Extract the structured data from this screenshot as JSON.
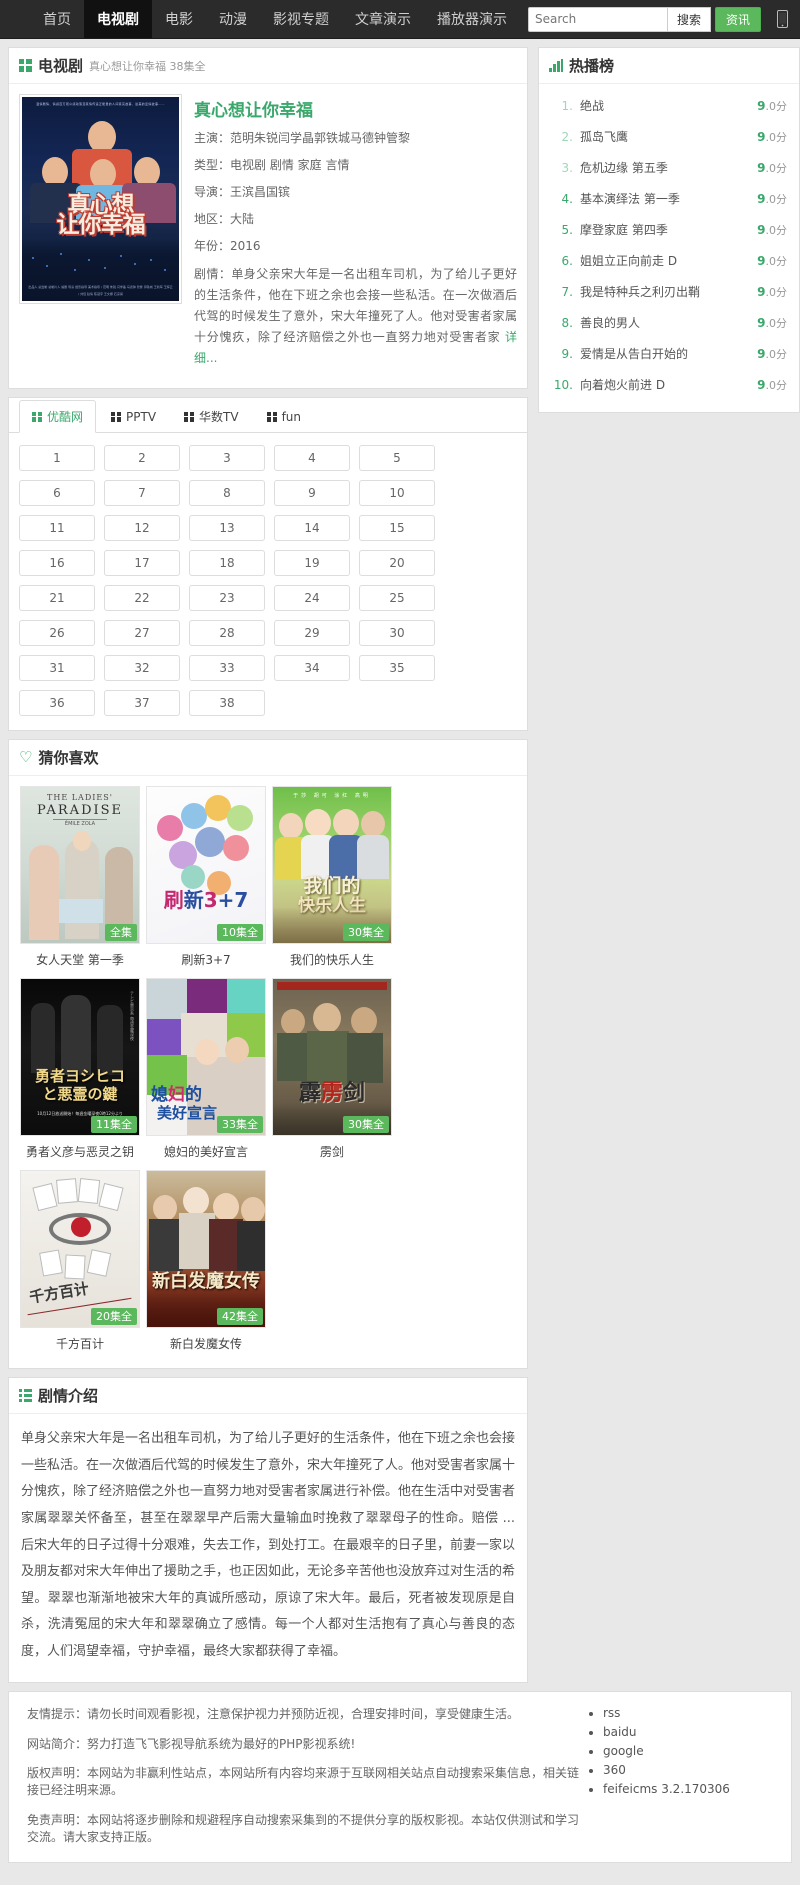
{
  "nav": {
    "items": [
      {
        "label": "首页",
        "active": false
      },
      {
        "label": "电视剧",
        "active": true
      },
      {
        "label": "电影",
        "active": false
      },
      {
        "label": "动漫",
        "active": false
      },
      {
        "label": "影视专题",
        "active": false
      },
      {
        "label": "文章演示",
        "active": false
      },
      {
        "label": "播放器演示",
        "active": false
      }
    ],
    "search_placeholder": "Search",
    "search_value": "",
    "search_button": "搜索",
    "news_button": "资讯",
    "mobile_icon": "mobile-phone-icon"
  },
  "detail": {
    "header_title": "电视剧",
    "header_sub": "真心想让你幸福 38集全",
    "header_icon": "tv-grid-icon",
    "poster_title_line1": "真心想",
    "poster_title_line2": "让你幸福",
    "poster_top_text": "温情剧情、情感百万观众感动落泪真情传递正能量的人间真实故事、最美的爱情故事……",
    "poster_credits": "出品人 总监制 总制片人 编剧 导演 摄影指导 美术指导 / 范明 朱锐 闫学晶 马德钟 管黎 郭铁城 王新军 王辉云 / 刘佳 赵倩 陈冠宇 王文娜 石凉澜",
    "title": "真心想让你幸福",
    "fields": [
      {
        "label": "主演",
        "value": "范明朱锐闫学晶郭铁城马德钟管黎"
      },
      {
        "label": "类型",
        "value": "电视剧 剧情 家庭 言情"
      },
      {
        "label": "导演",
        "value": "王滨昌国镔"
      },
      {
        "label": "地区",
        "value": "大陆"
      },
      {
        "label": "年份",
        "value": "2016"
      }
    ],
    "plot_label": "剧情",
    "plot_excerpt": "单身父亲宋大年是一名出租车司机，为了给儿子更好的生活条件，他在下班之余也会接一些私活。在一次做酒后代驾的时候发生了意外，宋大年撞死了人。他对受害者家属十分愧疚，除了经济赔偿之外也一直努力地对受害者家",
    "more_label": "详细..."
  },
  "sources": {
    "tabs": [
      {
        "label": "优酷网",
        "active": true
      },
      {
        "label": "PPTV",
        "active": false
      },
      {
        "label": "华数TV",
        "active": false
      },
      {
        "label": "fun",
        "active": false
      }
    ],
    "episodes": [
      "1",
      "2",
      "3",
      "4",
      "5",
      "6",
      "7",
      "8",
      "9",
      "10",
      "11",
      "12",
      "13",
      "14",
      "15",
      "16",
      "17",
      "18",
      "19",
      "20",
      "21",
      "22",
      "23",
      "24",
      "25",
      "26",
      "27",
      "28",
      "29",
      "30",
      "31",
      "32",
      "33",
      "34",
      "35",
      "36",
      "37",
      "38"
    ]
  },
  "recommend": {
    "header_title": "猜你喜欢",
    "header_icon": "heart-icon",
    "items": [
      {
        "name": "女人天堂 第一季",
        "badge": "全集",
        "poster_style": "ladies"
      },
      {
        "name": "刷新3+7",
        "badge": "10集全",
        "poster_style": "refresh"
      },
      {
        "name": "我们的快乐人生",
        "badge": "30集全",
        "poster_style": "happylife"
      },
      {
        "name": "勇者义彦与恶灵之钥",
        "badge": "11集全",
        "poster_style": "yoshihiko"
      },
      {
        "name": "媳妇的美好宣言",
        "badge": "33集全",
        "poster_style": "xifu"
      },
      {
        "name": "雳剑",
        "badge": "30集全",
        "poster_style": "lijian"
      },
      {
        "name": "千方百计",
        "badge": "20集全",
        "poster_style": "qianfang"
      },
      {
        "name": "新白发魔女传",
        "badge": "42集全",
        "poster_style": "baifa"
      }
    ]
  },
  "synopsis": {
    "header_title": "剧情介绍",
    "header_icon": "list-icon",
    "text": "单身父亲宋大年是一名出租车司机，为了给儿子更好的生活条件，他在下班之余也会接一些私活。在一次做酒后代驾的时候发生了意外，宋大年撞死了人。他对受害者家属十分愧疚，除了经济赔偿之外也一直努力地对受害者家属进行补偿。他在生活中对受害者家属翠翠关怀备至，甚至在翠翠早产后需大量输血时挽救了翠翠母子的性命。赔偿 ... 后宋大年的日子过得十分艰难，失去工作，到处打工。在最艰辛的日子里，前妻一家以及朋友都对宋大年伸出了援助之手，也正因如此，无论多辛苦他也没放弃过对生活的希望。翠翠也渐渐地被宋大年的真诚所感动，原谅了宋大年。最后，死者被发现原是自杀，洗清冤屈的宋大年和翠翠确立了感情。每一个人都对生活抱有了真心与善良的态度，人们渴望幸福，守护幸福，最终大家都获得了幸福。"
  },
  "ranking": {
    "header_title": "热播榜",
    "header_icon": "bar-chart-icon",
    "items": [
      {
        "no": "1.",
        "name": "绝战",
        "score_main": "9",
        "score_rest": ".0分"
      },
      {
        "no": "2.",
        "name": "孤岛飞鹰",
        "score_main": "9",
        "score_rest": ".0分"
      },
      {
        "no": "3.",
        "name": "危机边缘 第五季",
        "score_main": "9",
        "score_rest": ".0分"
      },
      {
        "no": "4.",
        "name": "基本演绎法 第一季",
        "score_main": "9",
        "score_rest": ".0分"
      },
      {
        "no": "5.",
        "name": "摩登家庭 第四季",
        "score_main": "9",
        "score_rest": ".0分"
      },
      {
        "no": "6.",
        "name": "姐姐立正向前走 D",
        "score_main": "9",
        "score_rest": ".0分"
      },
      {
        "no": "7.",
        "name": "我是特种兵之利刃出鞘",
        "score_main": "9",
        "score_rest": ".0分"
      },
      {
        "no": "8.",
        "name": "善良的男人",
        "score_main": "9",
        "score_rest": ".0分"
      },
      {
        "no": "9.",
        "name": "爱情是从告白开始的",
        "score_main": "9",
        "score_rest": ".0分"
      },
      {
        "no": "10.",
        "name": "向着炮火前进 D",
        "score_main": "9",
        "score_rest": ".0分"
      }
    ]
  },
  "footer": {
    "lines": [
      "友情提示：请勿长时间观看影视，注意保护视力并预防近视，合理安排时间，享受健康生活。",
      "网站简介：努力打造飞飞影视导航系统为最好的PHP影视系统!",
      "版权声明：本网站为非赢利性站点，本网站所有内容均来源于互联网相关站点自动搜索采集信息，相关链接已经注明来源。",
      "免责声明：本网站将逐步删除和规避程序自动搜索采集到的不提供分享的版权影视。本站仅供测试和学习交流。请大家支持正版。"
    ],
    "links": [
      "rss",
      "baidu",
      "google",
      "360",
      "feifeicms 3.2.170306"
    ]
  },
  "colors": {
    "accent": "#3aa86b",
    "green_button": "#5cb85c",
    "nav_bg": "#2b2b2b",
    "page_bg": "#e8e8e8"
  }
}
